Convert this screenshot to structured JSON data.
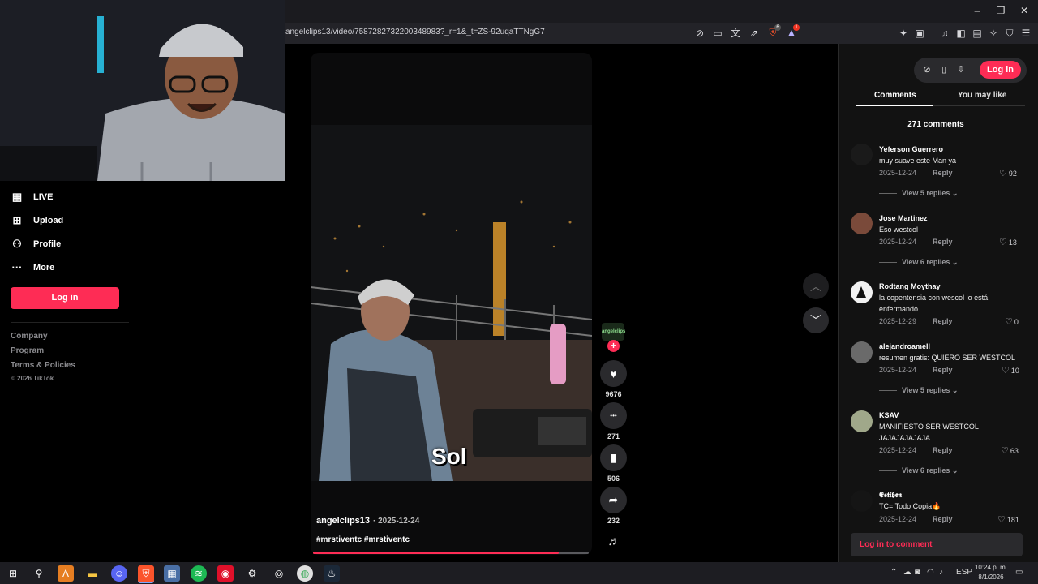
{
  "browser": {
    "url": "angelclips13/video/7587282732200348983?_r=1&_t=ZS-92uqaTTNgG7",
    "toolbar_icons": [
      "translate-icon",
      "screen-cast-icon",
      "reader-icon",
      "share-icon",
      "brave-shield-icon",
      "rewards-icon",
      "extensions-icon",
      "sidebar-icon",
      "music-icon",
      "panel-icon",
      "wallet-icon",
      "leo-icon",
      "vpn-icon",
      "menu-icon"
    ],
    "brave_badge": "6",
    "rewards_badge": "1"
  },
  "sidebar": {
    "items": [
      {
        "icon": "live-icon",
        "label": "LIVE"
      },
      {
        "icon": "upload-icon",
        "label": "Upload"
      },
      {
        "icon": "profile-icon",
        "label": "Profile"
      },
      {
        "icon": "more-icon",
        "label": "More"
      }
    ],
    "login_label": "Log in",
    "footer": [
      "Company",
      "Program",
      "Terms & Policies",
      "© 2026 TikTok"
    ]
  },
  "video": {
    "caption_word": "Sol",
    "author": "angelclips13",
    "date": "· 2025-12-24",
    "hashtags": "#mrstiventc #mrstiventc",
    "progress": 0.89,
    "author_avatar_text": "angelclips",
    "actions": [
      {
        "icon": "heart-icon",
        "glyph": "♥",
        "count": "9676"
      },
      {
        "icon": "comment-icon",
        "glyph": "•••",
        "count": "271"
      },
      {
        "icon": "bookmark-icon",
        "glyph": "▮",
        "count": "506"
      },
      {
        "icon": "share-icon",
        "glyph": "➦",
        "count": "232"
      }
    ]
  },
  "panel": {
    "login_label": "Log in",
    "tabs": [
      "Comments",
      "You may like"
    ],
    "comment_count": "271 comments",
    "comments": [
      {
        "user": "Yeferson Guerrero",
        "text": "muy suave este Man ya",
        "date": "2025-12-24",
        "reply": "Reply",
        "likes": "92",
        "replies": "View 5 replies",
        "avatar_color": "#1a1a1a"
      },
      {
        "user": "Jose Martinez",
        "text": "Eso westcol",
        "date": "2025-12-24",
        "reply": "Reply",
        "likes": "13",
        "replies": "View 6 replies",
        "avatar_color": "#7a4a3a"
      },
      {
        "user": "Rodtang Moythay",
        "text": "la copentensia con wescol lo está enfermando",
        "date": "2025-12-29",
        "reply": "Reply",
        "likes": "0",
        "replies": "",
        "avatar_color": "#f2f2f2"
      },
      {
        "user": "alejandroamell",
        "text": "resumen gratis: QUIERO SER WESTCOL",
        "date": "2025-12-24",
        "reply": "Reply",
        "likes": "10",
        "replies": "View 5 replies",
        "avatar_color": "#6a6a6a"
      },
      {
        "user": "KSAV",
        "text": "MANIFIESTO SER WESTCOL JAJAJAJAJAJA",
        "date": "2025-12-24",
        "reply": "Reply",
        "likes": "63",
        "replies": "View 6 replies",
        "avatar_color": "#a0a88a"
      },
      {
        "user": "𝕰𝖘𝖙𝖎𝖇𝖊𝖓",
        "text": "TC= Todo Copia🔥",
        "date": "2025-12-24",
        "reply": "Reply",
        "likes": "181",
        "replies": "",
        "avatar_color": "#151515"
      }
    ],
    "comment_input": "Log in to comment"
  },
  "taskbar": {
    "tray_lang": "ESP",
    "time": "10:24 p. m.",
    "date": "8/1/2026"
  },
  "colors": {
    "accent": "#fe2c55",
    "bg": "#000000",
    "panel": "#121212"
  }
}
